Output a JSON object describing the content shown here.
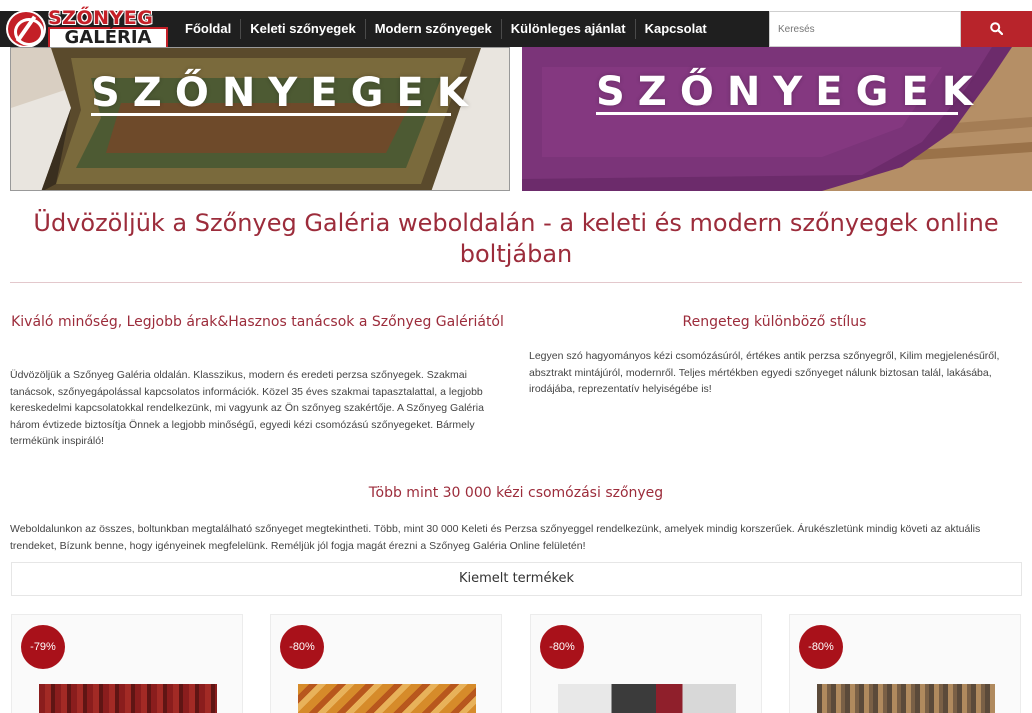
{
  "logo": {
    "line1": "SZŐNYEG",
    "line2": "GALÉRIA"
  },
  "nav": {
    "items": [
      {
        "label": "Főoldal"
      },
      {
        "label": "Keleti szőnyegek"
      },
      {
        "label": "Modern szőnyegek"
      },
      {
        "label": "Különleges ajánlat"
      },
      {
        "label": "Kapcsolat"
      }
    ]
  },
  "search": {
    "placeholder": "Keresés",
    "button_icon": "search-icon",
    "button_color": "#b8242b"
  },
  "banners": [
    {
      "text": "SZŐNYEGEK"
    },
    {
      "text": "SZŐNYEGEK"
    }
  ],
  "main": {
    "title": "Üdvözöljük a Szőnyeg Galéria weboldalán - a keleti és modern szőnyegek online boltjában",
    "col1": {
      "heading": "Kiváló minőség, Legjobb árak&Hasznos tanácsok a Szőnyeg Galériától",
      "text": "Üdvözöljük a Szőnyeg Galéria oldalán. Klasszikus, modern és eredeti perzsa szőnyegek. Szakmai tanácsok, szőnyegápolással kapcsolatos információk. Közel 35 éves szakmai tapasztalattal, a legjobb kereskedelmi kapcsolatokkal rendelkezünk, mi vagyunk az Ön szőnyeg szakértője. A Szőnyeg Galéria három évtizede biztosítja Önnek a legjobb minőségű, egyedi kézi csomózású szőnyegeket. Bármely termékünk inspiráló!"
    },
    "col2": {
      "heading": "Rengeteg különböző stílus",
      "text": "Legyen szó hagyományos kézi csomózásúról, értékes antik perzsa szőnyegről, Kilim megjelenésűről, absztrakt mintájúról, modernről. Teljes mértékben egyedi szőnyeget nálunk biztosan talál, lakásába, irodájába, reprezentatív helyiségébe is!"
    },
    "section_title": "Több mint 30 000 kézi csomózási szőnyeg",
    "section_text": "Weboldalunkon az összes, boltunkban megtalálható szőnyeget megtekintheti. Több, mint 30 000 Keleti és Perzsa szőnyeggel rendelkezünk, amelyek mindig korszerűek. Árukészletünk mindig követi az aktuális trendeket, Bízunk benne, hogy igényeinek megfelelünk. Reméljük jól fogja magát érezni a Szőnyeg Galéria Online felületén!"
  },
  "featured": {
    "title": "Kiemelt termékek",
    "products": [
      {
        "discount": "-79%"
      },
      {
        "discount": "-80%"
      },
      {
        "discount": "-80%"
      },
      {
        "discount": "-80%"
      }
    ]
  },
  "colors": {
    "accent": "#9c2c3b",
    "nav_bg": "#1f1f1f",
    "badge": "#a9111a"
  }
}
